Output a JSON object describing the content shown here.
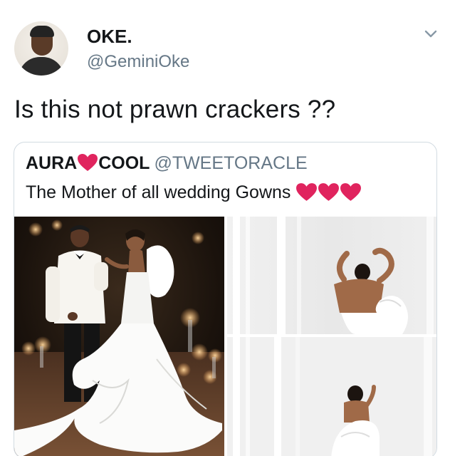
{
  "tweet": {
    "author_name": "OKE.",
    "author_handle": "@GeminiOke",
    "text": "Is this not prawn crackers ??"
  },
  "quoted_tweet": {
    "author_name_prefix": "AURA",
    "author_name_suffix": "COOL",
    "author_handle": "@TWEETORACLE",
    "text": "The Mother of all wedding Gowns"
  },
  "icons": {
    "menu": "chevron-down-icon",
    "name_emoji": "red-heart-icon",
    "text_emoji": "red-heart-icon"
  },
  "colors": {
    "secondary_text": "#657786",
    "heart": "#e0245e",
    "border": "#d2dbe2"
  }
}
